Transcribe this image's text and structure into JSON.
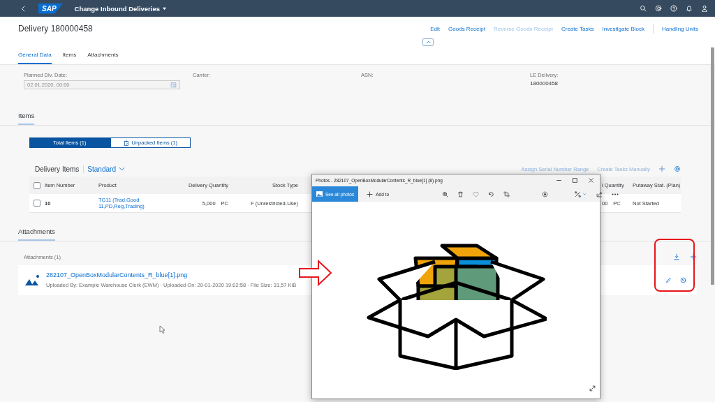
{
  "shell": {
    "logo": "SAP",
    "title": "Change Inbound Deliveries"
  },
  "header": {
    "title": "Delivery 180000458",
    "actions": [
      {
        "label": "Edit",
        "disabled": false
      },
      {
        "label": "Goods Receipt",
        "disabled": false
      },
      {
        "label": "Reverse Goods Receipt",
        "disabled": true
      },
      {
        "label": "Create Tasks",
        "disabled": false
      },
      {
        "label": "Investigate Block",
        "disabled": false
      }
    ],
    "extra_action": "Handling Units"
  },
  "tabs": [
    {
      "label": "General Data",
      "selected": true
    },
    {
      "label": "Items",
      "selected": false
    },
    {
      "label": "Attachments",
      "selected": false
    }
  ],
  "general": {
    "fields": [
      {
        "kind": "date",
        "label": "Planned Dlv. Date:",
        "value": "02.01.2020, 00:00",
        "disabled": true
      },
      {
        "kind": "text",
        "label": "Carrier:"
      },
      {
        "kind": "text",
        "label": "ASN:"
      },
      {
        "kind": "text",
        "label": "LE Delivery:",
        "value": "180000458"
      }
    ]
  },
  "items": {
    "title": "Items",
    "segments": [
      {
        "label": "Total Items (1)",
        "selected": true
      },
      {
        "label": "Unpacked Items (1)",
        "selected": false
      }
    ],
    "table": {
      "select_all_checked": false,
      "title": "Delivery Items",
      "variant": "Standard",
      "actions": [
        "Assign Serial Number Range",
        "Create Tasks Manually"
      ],
      "columns": [
        {
          "label": "Item Number",
          "kind": "text"
        },
        {
          "label": "Product",
          "kind": "link"
        },
        {
          "label": "Delivery Quantity",
          "kind": "qty"
        },
        {
          "label": "Stock Type",
          "kind": "right"
        },
        {
          "label": "l Quantity",
          "kind": "qty"
        },
        {
          "label": "Putaway Stat. (Plan)",
          "kind": "text"
        }
      ],
      "rows": [
        {
          "checked": false,
          "cells": [
            {
              "value": "10"
            },
            {
              "value": "TG11 (Trad.Good 11,PD,Reg,Trading)"
            },
            {
              "value": "5,000",
              "unit": "PC"
            },
            {
              "value": "F (Unrestricted-Use)"
            },
            {
              "value": "00",
              "unit": "PC"
            },
            {
              "value": "Not Started"
            }
          ]
        }
      ]
    }
  },
  "attachments": {
    "title": "Attachments",
    "count_label": "Attachments (1)",
    "files": [
      {
        "name": "282107_OpenBoxModularContents_R_blue[1].png",
        "meta": "Uploaded By: Example Warehouse Clerk (EWM) · Uploaded On: 20-01-2020 19:02:58 · File Size: 31,57 KiB"
      }
    ]
  },
  "photos_window": {
    "title": "Photos - 282107_OpenBoxModularContents_R_blue[1] (8).png",
    "see_all": "See all photos",
    "add_to": "Add to"
  }
}
